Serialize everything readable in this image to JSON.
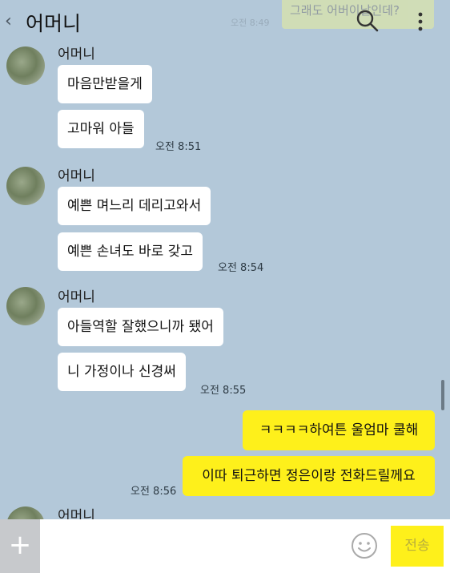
{
  "header": {
    "back_icon": "chevron-left-icon",
    "title": "어머니",
    "ghost_message": "그래도 어버이날인데?",
    "ghost_time": "오전 8:49",
    "search_icon": "search-icon",
    "more_icon": "more-vertical-icon"
  },
  "messages": {
    "group1": {
      "sender": "어머니",
      "bubble1": "마음만받을게",
      "bubble2": "고마워 아들",
      "time": "오전 8:51"
    },
    "group2": {
      "sender": "어머니",
      "bubble1": "예쁜 며느리 데리고와서",
      "bubble2": "예쁜 손녀도 바로 갖고",
      "time": "오전 8:54"
    },
    "group3": {
      "sender": "어머니",
      "bubble1": "아들역할 잘했으니까 됐어",
      "bubble2": "니 가정이나 신경써",
      "time": "오전 8:55"
    },
    "mine": {
      "bubble1": "ㅋㅋㅋㅋ하여튼 울엄마 쿨해",
      "bubble2": "이따 퇴근하면 정은이랑 전화드릴께요",
      "time": "오전 8:56"
    },
    "group4": {
      "sender": "어머니"
    }
  },
  "input_bar": {
    "plus_icon": "plus-icon",
    "placeholder": "",
    "emoji_icon": "emoji-icon",
    "send_label": "전송"
  },
  "colors": {
    "background": "#b3c8d9",
    "my_bubble": "#fef01b",
    "their_bubble": "#ffffff"
  }
}
